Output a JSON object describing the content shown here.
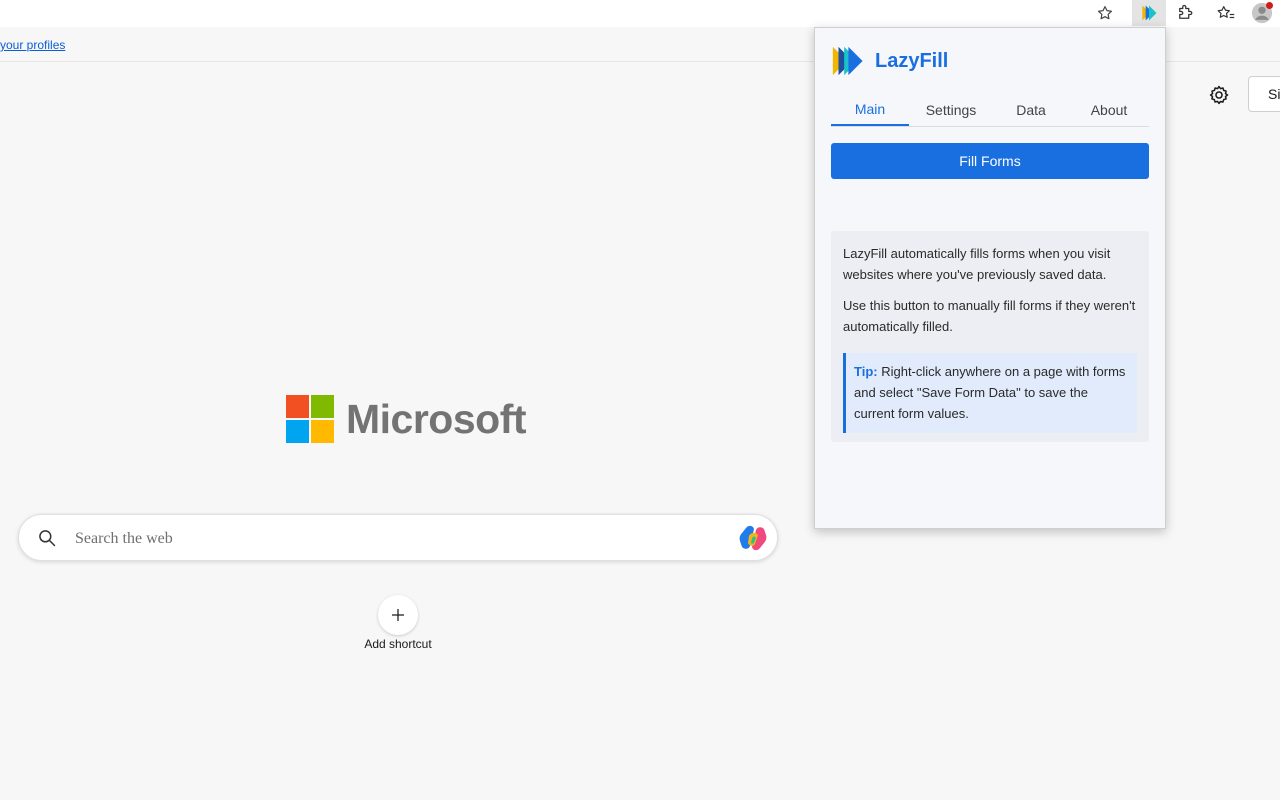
{
  "profile_bar": {
    "link_text": " your profiles"
  },
  "page": {
    "signin_label": "Sign in",
    "ms_word": "Microsoft",
    "search_placeholder": "Search the web",
    "add_shortcut_label": "Add shortcut"
  },
  "popup": {
    "title": "LazyFill",
    "tabs": [
      {
        "label": "Main",
        "active": true
      },
      {
        "label": "Settings",
        "active": false
      },
      {
        "label": "Data",
        "active": false
      },
      {
        "label": "About",
        "active": false
      }
    ],
    "fill_button_label": "Fill Forms",
    "info_p1": "LazyFill automatically fills forms when you visit websites where you've previously saved data.",
    "info_p2": "Use this button to manually fill forms if they weren't automatically filled.",
    "tip_label": "Tip:",
    "tip_text": " Right-click anywhere on a page with forms and select \"Save Form Data\" to save the current form values."
  },
  "colors": {
    "accent": "#1a6fe0",
    "ms_red": "#f25022",
    "ms_green": "#7fba00",
    "ms_blue": "#00a4ef",
    "ms_yellow": "#ffb900"
  },
  "icons": {
    "toolbar": [
      "star-icon",
      "lazyfill-extension-icon",
      "extensions-puzzle-icon",
      "favorites-icon",
      "profile-avatar-icon"
    ],
    "page": [
      "gear-icon",
      "search-icon",
      "copilot-icon",
      "plus-icon"
    ]
  }
}
